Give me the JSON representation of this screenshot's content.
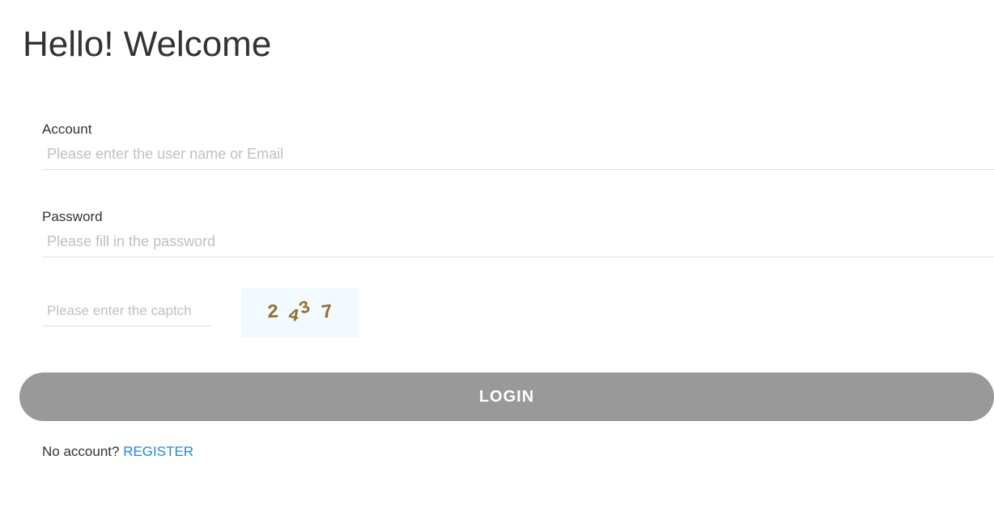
{
  "header": {
    "title": "Hello! Welcome"
  },
  "form": {
    "account": {
      "label": "Account",
      "placeholder": "Please enter the user name or Email",
      "value": ""
    },
    "password": {
      "label": "Password",
      "placeholder": "Please fill in the password",
      "value": ""
    },
    "captcha": {
      "placeholder": "Please enter the captch",
      "value": "",
      "chars": [
        "2",
        "4",
        "3",
        "7"
      ]
    },
    "login_label": "LOGIN"
  },
  "footer": {
    "no_account_text": "No account? ",
    "register_label": "REGISTER"
  }
}
